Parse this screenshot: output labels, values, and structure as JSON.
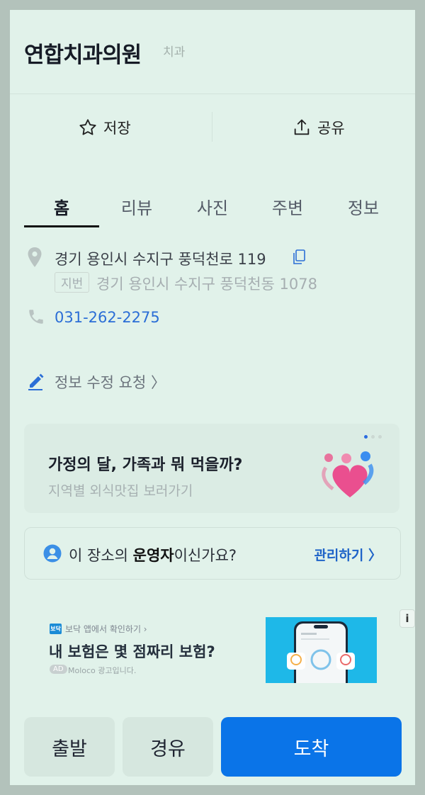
{
  "place": {
    "name": "연합치과의원",
    "category": "치과"
  },
  "actions": {
    "save_label": "저장",
    "share_label": "공유"
  },
  "tabs": [
    {
      "label": "홈",
      "active": true
    },
    {
      "label": "리뷰"
    },
    {
      "label": "사진"
    },
    {
      "label": "주변"
    },
    {
      "label": "정보"
    }
  ],
  "info": {
    "address": "경기 용인시 수지구 풍덕천로 119",
    "jibun_tag": "지번",
    "jibun_address": "경기 용인시 수지구 풍덕천동 1078",
    "phone": "031-262-2275",
    "edit_request": "정보 수정 요청 〉"
  },
  "promo": {
    "title": "가정의 달, 가족과 뭐 먹을까?",
    "subtitle": "지역별 외식맛집 보러가기"
  },
  "owner": {
    "text_before": "이 장소의 ",
    "text_bold": "운영자",
    "text_after": "이신가요?",
    "link": "관리하기 〉"
  },
  "ad": {
    "logo": "보닥",
    "small_text": "보닥 앱에서 확인하기 ›",
    "title": "내 보험은 몇 점짜리 보험?",
    "tag": "AD",
    "note": "Moloco 광고입니다.",
    "info_icon": "i"
  },
  "bottom": {
    "depart": "출발",
    "via": "경유",
    "arrive": "도착"
  },
  "colors": {
    "accent": "#0a74e8",
    "link": "#2b6ed6",
    "background": "#e1f2ea"
  }
}
